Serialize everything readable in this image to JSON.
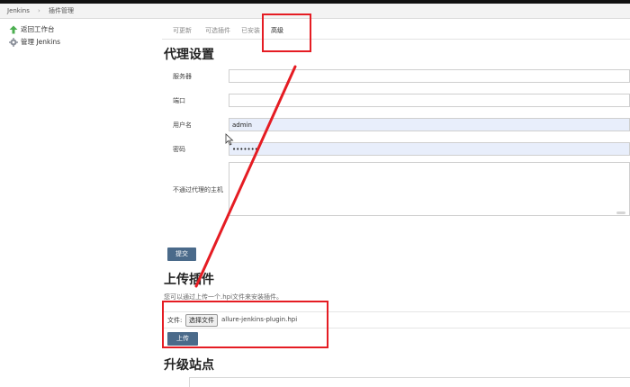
{
  "breadcrumb": {
    "home": "Jenkins",
    "separator": "›",
    "current": "插件管理"
  },
  "sidebar": {
    "items": [
      {
        "label": "返回工作台",
        "icon": "up-arrow-icon"
      },
      {
        "label": "管理 Jenkins",
        "icon": "gear-icon"
      }
    ]
  },
  "tabs": [
    {
      "label": "可更新",
      "active": false
    },
    {
      "label": "可选插件",
      "active": false
    },
    {
      "label": "已安装",
      "active": false
    },
    {
      "label": "高级",
      "active": true
    }
  ],
  "proxy": {
    "title": "代理设置",
    "server_label": "服务器",
    "server_value": "",
    "port_label": "端口",
    "port_value": "",
    "username_label": "用户名",
    "username_value": "admin",
    "password_label": "密码",
    "password_value": "•••••••",
    "no_proxy_label": "不通过代理的主机",
    "submit_label": "提交"
  },
  "upload": {
    "title": "上传插件",
    "help": "您可以通过上传一个.hpi文件来安装插件。",
    "file_label": "文件:",
    "choose_button": "选择文件",
    "file_name": "allure-jenkins-plugin.hpi",
    "upload_button": "上传"
  },
  "update_site": {
    "title": "升级站点"
  },
  "colors": {
    "button_bg": "#4a6a8a",
    "annotation": "#e51c23",
    "autofill_bg": "#e8eefb"
  }
}
